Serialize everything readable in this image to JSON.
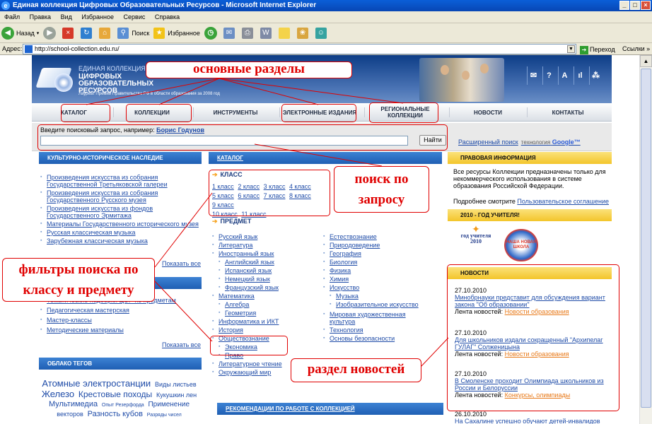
{
  "window": {
    "title": "Единая коллекция Цифровых Образовательных Ресурсов - Microsoft Internet Explorer",
    "buttons": [
      "_",
      "□",
      "×"
    ]
  },
  "menu": [
    "Файл",
    "Правка",
    "Вид",
    "Избранное",
    "Сервис",
    "Справка"
  ],
  "toolbar": {
    "back": "Назад",
    "search": "Поиск",
    "favorites": "Избранное"
  },
  "address": {
    "label": "Адрес:",
    "url": "http://school-collection.edu.ru/",
    "go": "Переход",
    "links": "Ссылки »"
  },
  "header": {
    "brand_small": "ЕДИНАЯ КОЛЛЕКЦИЯ",
    "brand_big": "ЦИФРОВЫХ ОБРАЗОВАТЕЛЬНЫХ РЕСУРСОВ",
    "brand_note": "Лауреат Премии Правительства РФ в области образования за 2008 год",
    "icons": [
      "✉",
      "?",
      "A",
      "ıl",
      "⁂"
    ]
  },
  "nav": [
    "КАТАЛОГ",
    "КОЛЛЕКЦИИ",
    "ИНСТРУМЕНТЫ",
    "ЭЛЕКТРОННЫЕ ИЗДАНИЯ",
    "РЕГИОНАЛЬНЫЕ КОЛЛЕКЦИИ",
    "НОВОСТИ",
    "КОНТАКТЫ"
  ],
  "search": {
    "label": "Введите поисковый запрос, например:",
    "example": "Борис Годунов",
    "button": "Найти",
    "advanced": "Расширенный поиск",
    "tech": "технология",
    "google": "Google™"
  },
  "left": {
    "heritage_title": "КУЛЬТУРНО-ИСТОРИЧЕСКОЕ НАСЛЕДИЕ",
    "heritage": [
      "Произведения искусства из собрания Государственной Третьяковской галереи",
      "Произведения искусства из собрания Государственного Русского музея",
      "Произведения искусства из фондов Государственного Эрмитажа",
      "Материалы Государственного исторического музея",
      "Русская классическая музыка",
      "Зарубежная классическая музыка"
    ],
    "show_all": "Показать все",
    "method": [
      "Тематические подборки ЦОР по предметам",
      "Педагогическая мастерская",
      "Мастер-классы",
      "Методические материалы"
    ],
    "show_all2": "Показать все",
    "tags_title": "ОБЛАКО ТЕГОВ",
    "tags": [
      "Атомные электростанции",
      "Виды листьев",
      "Железо",
      "Крестовые походы",
      "Кукушкин лен",
      "Мультимедиа",
      "Опыт Резерфорда",
      "Применение",
      "векторов",
      "Разность кубов",
      "Разряды чисел"
    ]
  },
  "center": {
    "catalog_title": "КАТАЛОГ",
    "class_title": "КЛАСС",
    "classes": [
      "1 класс",
      "2 класс",
      "3 класс",
      "4 класс",
      "5 класс",
      "6 класс",
      "7 класс",
      "8 класс",
      "9 класс",
      "10 класс",
      "11 класс"
    ],
    "subject_title": "ПРЕДМЕТ",
    "subjects_a": [
      "Русский язык",
      "Литература",
      "Иностранный язык"
    ],
    "langs": [
      "Английский язык",
      "Испанский язык",
      "Немецкий язык",
      "Французский язык"
    ],
    "math": "Математика",
    "math_sub": [
      "Алгебра",
      "Геометрия"
    ],
    "subjects_b": [
      "Информатика и ИКТ",
      "История",
      "Обществознание"
    ],
    "soc_sub": [
      "Экономика",
      "Право"
    ],
    "subjects_c": [
      "Литературное чтение",
      "Окружающий мир"
    ],
    "subjects_r": [
      "Естествознание",
      "Природоведение",
      "География",
      "Биология",
      "Физика",
      "Химия",
      "Искусство"
    ],
    "art_sub": [
      "Музыка",
      "Изобразительное искусство"
    ],
    "subjects_r2": [
      "Мировая художественная культура",
      "Технология",
      "Основы безопасности"
    ],
    "recommend": "РЕКОМЕНДАЦИИ ПО РАБОТЕ С КОЛЛЕКЦИЕЙ"
  },
  "right": {
    "legal_title": "ПРАВОВАЯ ИНФОРМАЦИЯ",
    "legal_text": "Все ресурсы Коллекции предназначены только для некоммерческого использования в системе образования Российской Федерации.",
    "legal_more": "Подробнее смотрите",
    "legal_link": "Пользовательское соглашение",
    "year_title": "2010 - ГОД УЧИТЕЛЯ!",
    "year_logo1": "год учителя 2010",
    "year_logo2": "НАША НОВАЯ ШКОЛА",
    "news_title": "НОВОСТИ",
    "news": [
      {
        "date": "27.10.2010",
        "title": "Минобрнауки представит для обсуждения вариант закона \"Об образовании\"",
        "label": "Лента новостей:",
        "feed": "Новости образования"
      },
      {
        "date": "27.10.2010",
        "title": "Для школьников издали сокращенный \"Архипелаг ГУЛАГ\" Солженицына",
        "label": "Лента новостей:",
        "feed": "Новости образования"
      },
      {
        "date": "27.10.2010",
        "title": "В Смоленске проходит Олимпиада школьников из России и Белоруссии",
        "label": "Лента новостей:",
        "feed": "Конкурсы, олимпиады"
      },
      {
        "date": "26.10.2010",
        "title": "На Сахалине успешно обучают детей-инвалидов"
      }
    ]
  },
  "callouts": {
    "sections": "основные разделы",
    "search": "поиск по запросу",
    "filters": "фильтры поиска по классу и предмету",
    "news": "раздел новостей"
  },
  "colors": {
    "accent": "#e00000",
    "link": "#1f4ca8",
    "header": "#0d3d87"
  }
}
